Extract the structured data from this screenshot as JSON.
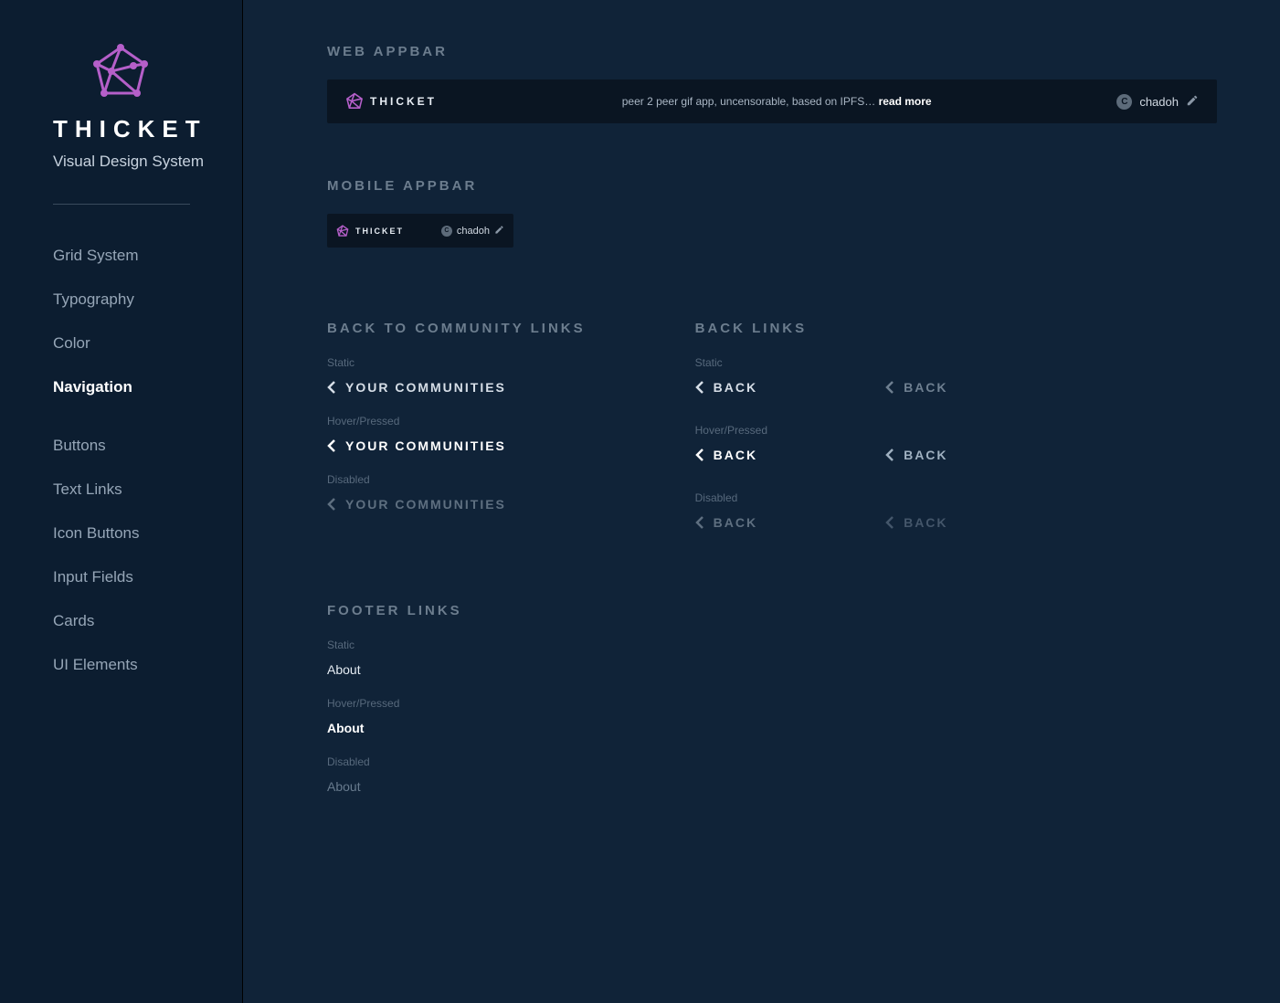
{
  "brand": {
    "name": "THICKET",
    "subtitle": "Visual Design System",
    "accent": "#b55fc9"
  },
  "nav": {
    "items": [
      "Grid System",
      "Typography",
      "Color",
      "Navigation",
      "Buttons",
      "Text Links",
      "Icon Buttons",
      "Input Fields",
      "Cards",
      "UI Elements"
    ],
    "active_index": 3
  },
  "sections": {
    "web_appbar": "WEB APPBAR",
    "mobile_appbar": "MOBILE APPBAR",
    "back_to_community": "BACK TO COMMUNITY LINKS",
    "back_links": "BACK LINKS",
    "footer_links": "FOOTER LINKS"
  },
  "states": {
    "static": "Static",
    "hover": "Hover/Pressed",
    "disabled": "Disabled"
  },
  "appbar": {
    "brand_label": "THICKET",
    "tagline_prefix": "peer 2 peer gif app, uncensorable, based on IPFS… ",
    "read_more": "read more",
    "username": "chadoh",
    "avatar_initial": "C"
  },
  "links": {
    "your_communities": "YOUR COMMUNITIES",
    "back": "BACK"
  },
  "footer": {
    "about": "About"
  }
}
